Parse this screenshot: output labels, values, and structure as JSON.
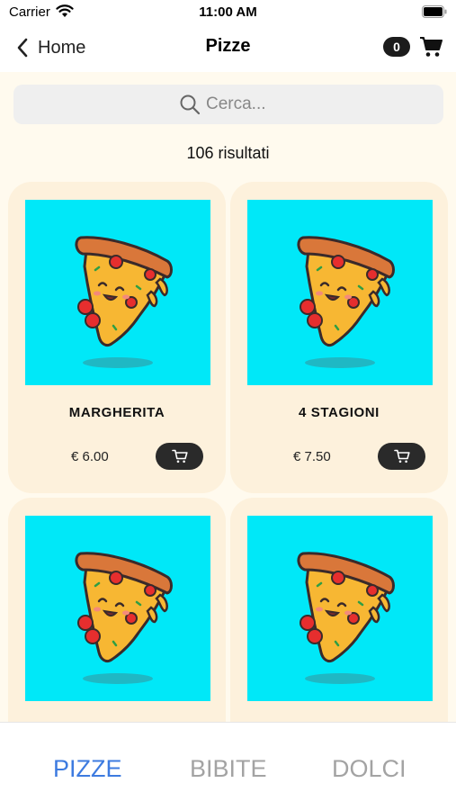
{
  "status_bar": {
    "carrier": "Carrier",
    "time": "11:00 AM"
  },
  "nav": {
    "back_label": "Home",
    "title": "Pizze",
    "cart_count": "0"
  },
  "search": {
    "placeholder": "Cerca..."
  },
  "results_label": "106 risultati",
  "products": [
    {
      "name": "MARGHERITA",
      "price": "€ 6.00"
    },
    {
      "name": "4 STAGIONI",
      "price": "€ 7.50"
    },
    {
      "name": "",
      "price": ""
    },
    {
      "name": "",
      "price": ""
    }
  ],
  "tabs": [
    {
      "label": "PIZZE",
      "active": true
    },
    {
      "label": "BIBITE",
      "active": false
    },
    {
      "label": "DOLCI",
      "active": false
    }
  ],
  "colors": {
    "accent": "#3d7be0",
    "content_background": "#fffaee",
    "card_background": "#fdf1dc",
    "image_background": "#00e8f8"
  },
  "icons": [
    "wifi-icon",
    "battery-icon",
    "chevron-left-icon",
    "cart-icon",
    "search-icon",
    "pizza-image",
    "add-to-cart-icon"
  ]
}
